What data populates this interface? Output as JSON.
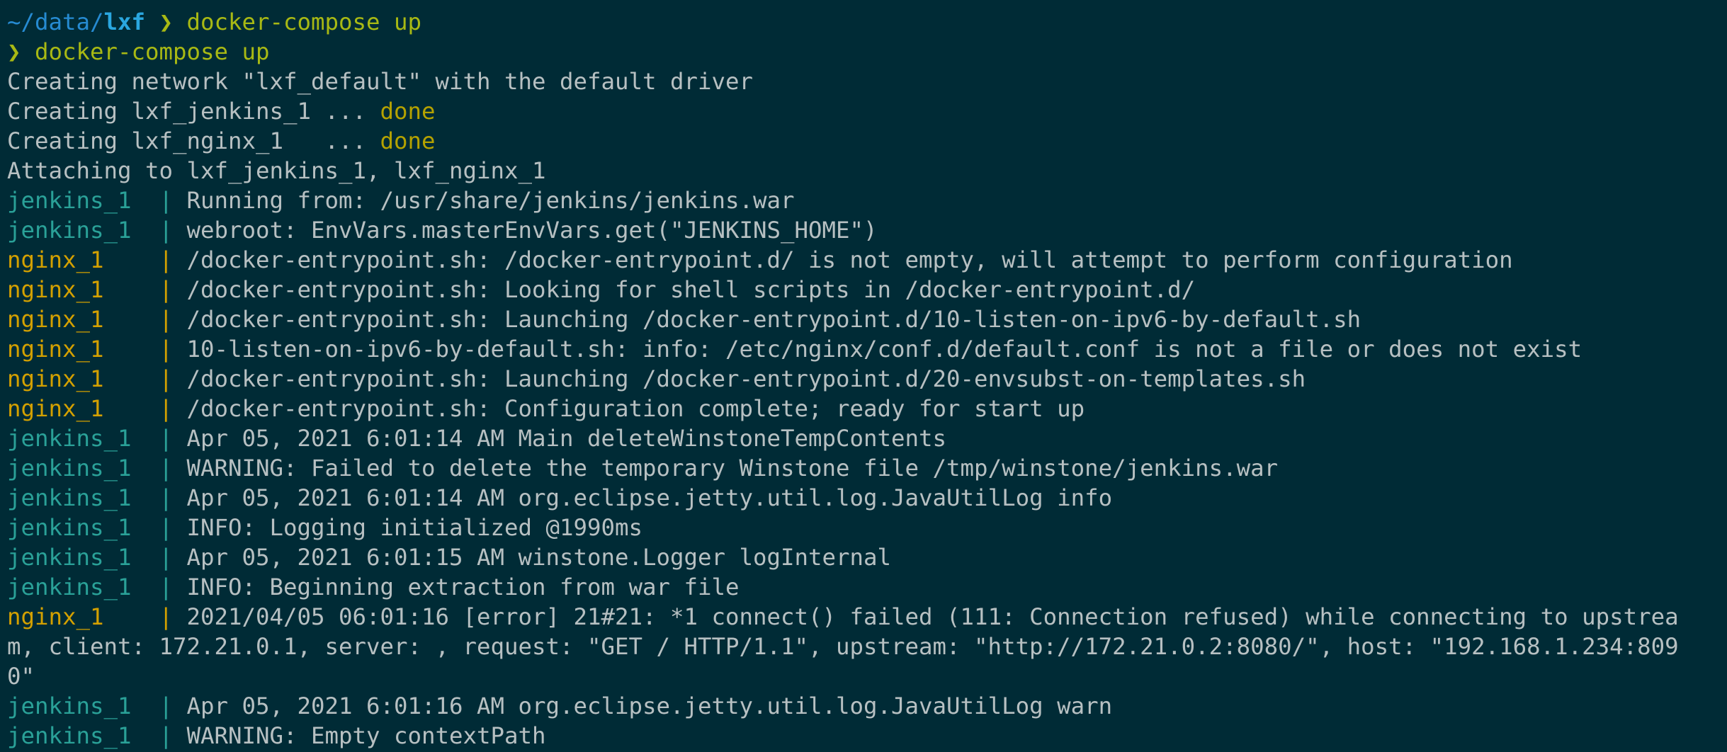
{
  "prompt_path_prefix": "~/data/",
  "prompt_dir": "lxf",
  "prompt_arrow": " ❯ ",
  "command": "docker-compose up",
  "echo_arrow": "❯ ",
  "echo_command": "docker-compose up",
  "creating_network": "Creating network \"lxf_default\" with the default driver",
  "creating": [
    {
      "text": "Creating lxf_jenkins_1 ... ",
      "status": "done"
    },
    {
      "text": "Creating lxf_nginx_1   ... ",
      "status": "done"
    }
  ],
  "attaching": "Attaching to lxf_jenkins_1, lxf_nginx_1",
  "colors": {
    "background": "#002b36",
    "jenkins": "#2aa198",
    "nginx": "#d3a000",
    "command": "#a8b914"
  },
  "logs": [
    {
      "service": "jenkins_1  | ",
      "kind": "jenkins",
      "message": "Running from: /usr/share/jenkins/jenkins.war"
    },
    {
      "service": "jenkins_1  | ",
      "kind": "jenkins",
      "message": "webroot: EnvVars.masterEnvVars.get(\"JENKINS_HOME\")"
    },
    {
      "service": "nginx_1    | ",
      "kind": "nginx",
      "message": "/docker-entrypoint.sh: /docker-entrypoint.d/ is not empty, will attempt to perform configuration"
    },
    {
      "service": "nginx_1    | ",
      "kind": "nginx",
      "message": "/docker-entrypoint.sh: Looking for shell scripts in /docker-entrypoint.d/"
    },
    {
      "service": "nginx_1    | ",
      "kind": "nginx",
      "message": "/docker-entrypoint.sh: Launching /docker-entrypoint.d/10-listen-on-ipv6-by-default.sh"
    },
    {
      "service": "nginx_1    | ",
      "kind": "nginx",
      "message": "10-listen-on-ipv6-by-default.sh: info: /etc/nginx/conf.d/default.conf is not a file or does not exist"
    },
    {
      "service": "nginx_1    | ",
      "kind": "nginx",
      "message": "/docker-entrypoint.sh: Launching /docker-entrypoint.d/20-envsubst-on-templates.sh"
    },
    {
      "service": "nginx_1    | ",
      "kind": "nginx",
      "message": "/docker-entrypoint.sh: Configuration complete; ready for start up"
    },
    {
      "service": "jenkins_1  | ",
      "kind": "jenkins",
      "message": "Apr 05, 2021 6:01:14 AM Main deleteWinstoneTempContents"
    },
    {
      "service": "jenkins_1  | ",
      "kind": "jenkins",
      "message": "WARNING: Failed to delete the temporary Winstone file /tmp/winstone/jenkins.war"
    },
    {
      "service": "jenkins_1  | ",
      "kind": "jenkins",
      "message": "Apr 05, 2021 6:01:14 AM org.eclipse.jetty.util.log.JavaUtilLog info"
    },
    {
      "service": "jenkins_1  | ",
      "kind": "jenkins",
      "message": "INFO: Logging initialized @1990ms"
    },
    {
      "service": "jenkins_1  | ",
      "kind": "jenkins",
      "message": "Apr 05, 2021 6:01:15 AM winstone.Logger logInternal"
    },
    {
      "service": "jenkins_1  | ",
      "kind": "jenkins",
      "message": "INFO: Beginning extraction from war file"
    },
    {
      "service": "nginx_1    | ",
      "kind": "nginx",
      "message": "2021/04/05 06:01:16 [error] 21#21: *1 connect() failed (111: Connection refused) while connecting to upstrea"
    },
    {
      "service": "",
      "kind": "wrap",
      "message": "m, client: 172.21.0.1, server: , request: \"GET / HTTP/1.1\", upstream: \"http://172.21.0.2:8080/\", host: \"192.168.1.234:809"
    },
    {
      "service": "",
      "kind": "wrap",
      "message": "0\""
    },
    {
      "service": "jenkins_1  | ",
      "kind": "jenkins",
      "message": "Apr 05, 2021 6:01:16 AM org.eclipse.jetty.util.log.JavaUtilLog warn"
    },
    {
      "service": "jenkins_1  | ",
      "kind": "jenkins",
      "message": "WARNING: Empty contextPath"
    }
  ]
}
